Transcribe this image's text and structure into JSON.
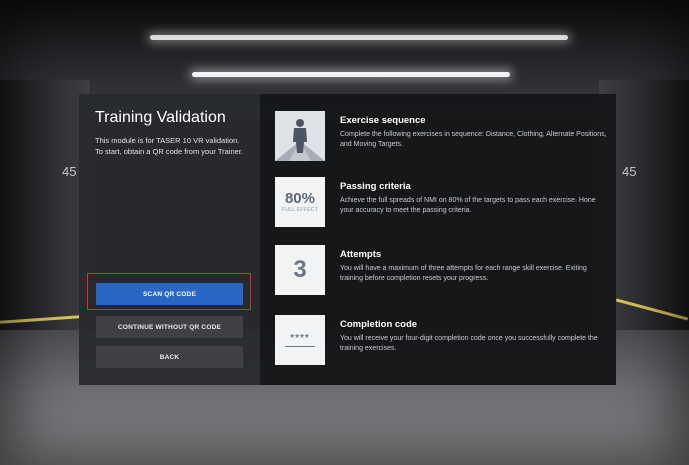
{
  "scene": {
    "lane_left": "45",
    "lane_right": "45"
  },
  "panel": {
    "title": "Training Validation",
    "description": "This module is for TASER 10 VR validation. To start, obtain a QR code from your Trainer.",
    "buttons": {
      "scan": "SCAN QR CODE",
      "continue": "CONTINUE WITHOUT QR CODE",
      "back": "BACK"
    }
  },
  "criteria": [
    {
      "title": "Exercise sequence",
      "text": "Complete the following exercises in sequence: Distance, Clothing, Alternate Positions, and Moving Targets.",
      "icon": "person-silhouette-icon"
    },
    {
      "title": "Passing criteria",
      "text": "Achieve the full spreads of NMI on 80% of the targets to pass each exercise. Hone your accuracy to meet the passing criteria.",
      "icon_value": "80%",
      "icon_caption": "FULL EFFECT"
    },
    {
      "title": "Attempts",
      "text": "You will have a maximum of three attempts for each range skill exercise. Exiting training before completion resets your progress.",
      "icon_value": "3"
    },
    {
      "title": "Completion code",
      "text": "You will receive your four-digit completion code once you successfully complete the training exercises.",
      "icon_value": "****"
    }
  ],
  "colors": {
    "primary_button": "#2a66c4",
    "highlight_border": "#d8322f"
  }
}
